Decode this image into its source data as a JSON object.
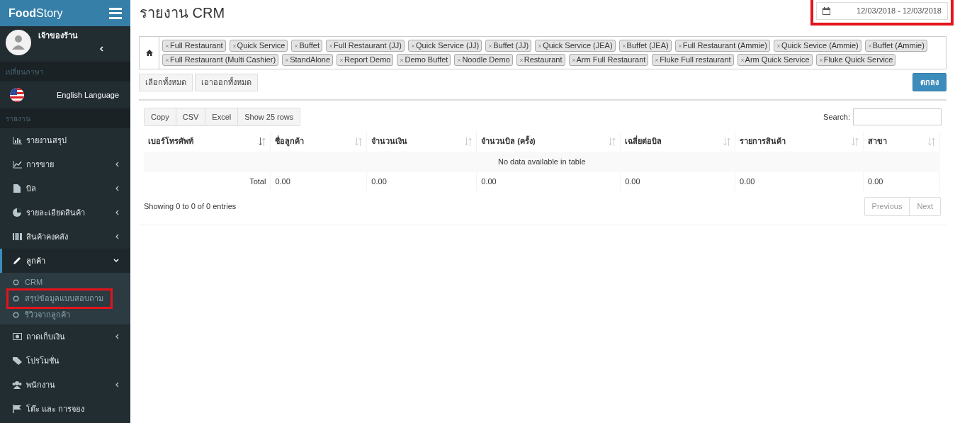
{
  "sidebar": {
    "logo": {
      "bold": "Food",
      "light": "Story"
    },
    "user": {
      "name": "เจ้าของร้าน"
    },
    "language_header": "เปลี่ยนภาษา",
    "language": "English Language",
    "report_header": "รายงาน",
    "items": [
      {
        "label": "รายงานสรุป",
        "selected": false
      },
      {
        "label": "การขาย",
        "expanded": false,
        "selected": false
      },
      {
        "label": "บิล",
        "expanded": false,
        "selected": false
      },
      {
        "label": "รายละเอียดสินค้า",
        "expanded": false,
        "selected": false
      },
      {
        "label": "สินค้าคงคลัง",
        "expanded": false,
        "selected": false
      },
      {
        "label": "ลูกค้า",
        "expanded": true,
        "selected": true,
        "children": [
          {
            "label": "CRM",
            "highlighted": false
          },
          {
            "label": "สรุปข้อมูลแบบสอบถาม",
            "highlighted": true
          },
          {
            "label": "รีวิวจากลูกค้า",
            "highlighted": false
          }
        ]
      },
      {
        "label": "ถาดเก็บเงิน",
        "expanded": false,
        "selected": false
      },
      {
        "label": "โปรโมชั่น",
        "selected": false
      },
      {
        "label": "พนักงาน",
        "expanded": false,
        "selected": false
      },
      {
        "label": "โต๊ะ และ การจอง",
        "selected": false
      }
    ]
  },
  "page": {
    "title_prefix": "รายงาน",
    "title": "CRM",
    "date_range": {
      "value": "12/03/2018 - 12/03/2018",
      "highlighted": true
    },
    "branches": [
      "Full Restaurant",
      "Quick Service",
      "Buffet",
      "Full Restaurant (JJ)",
      "Quick Service (JJ)",
      "Buffet (JJ)",
      "Quick Service (JEA)",
      "Buffet (JEA)",
      "Full Restaurant (Ammie)",
      "Quick Sevice (Ammie)",
      "Buffet (Ammie)",
      "Full Restaurant (Multi Cashier)",
      "StandAlone",
      "Report Demo",
      "Demo Buffet",
      "Noodle Demo",
      "Restaurant",
      "Arm Full Restaurant",
      "Fluke Full restaurant",
      "Arm Quick Service",
      "Fluke Quick Service"
    ],
    "select_all": "เลือกทั้งหมด",
    "remove_all": "เอาออกทั้งหมด",
    "submit": "ตกลง"
  },
  "table": {
    "buttons": [
      "Copy",
      "CSV",
      "Excel",
      "Show 25 rows"
    ],
    "search_label": "Search:",
    "columns": [
      {
        "label": "เบอร์โทรศัพท์",
        "sorted": true
      },
      {
        "label": "ชื่อลูกค้า",
        "sorted": false
      },
      {
        "label": "จำนวนเงิน",
        "sorted": false
      },
      {
        "label": "จำนวนบิล (ครั้ง)",
        "sorted": false
      },
      {
        "label": "เฉลี่ยต่อบิล",
        "sorted": false
      },
      {
        "label": "รายการสินค้า",
        "sorted": false
      },
      {
        "label": "สาขา",
        "sorted": false
      }
    ],
    "empty_message": "No data available in table",
    "total_row": [
      "Total",
      "0.00",
      "0.00",
      "0.00",
      "0.00",
      "0.00",
      "0.00"
    ],
    "info": "Showing 0 to 0 of 0 entries",
    "pagination": [
      "Previous",
      "Next"
    ]
  }
}
